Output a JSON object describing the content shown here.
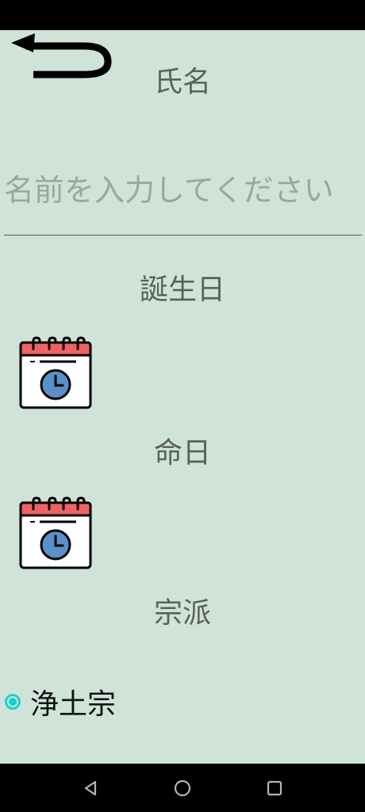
{
  "form": {
    "name_label": "氏名",
    "name_input": {
      "value": "",
      "placeholder": "名前を入力してください"
    },
    "birthday_label": "誕生日",
    "death_date_label": "命日",
    "sect_label": "宗派",
    "sect_options": [
      {
        "label": "浄土宗",
        "selected": true
      }
    ]
  },
  "colors": {
    "background": "#cfe3d9",
    "label_text": "#5b605d",
    "placeholder_text": "#9ea4a0",
    "radio_accent": "#1fcfcf",
    "calendar_header": "#f06363",
    "clock_face": "#5b8fc8"
  },
  "icons": {
    "back": "back-arrow-icon",
    "birthday_picker": "calendar-clock-icon",
    "death_date_picker": "calendar-clock-icon",
    "nav_back": "triangle-back-icon",
    "nav_home": "circle-home-icon",
    "nav_recents": "square-recents-icon"
  }
}
